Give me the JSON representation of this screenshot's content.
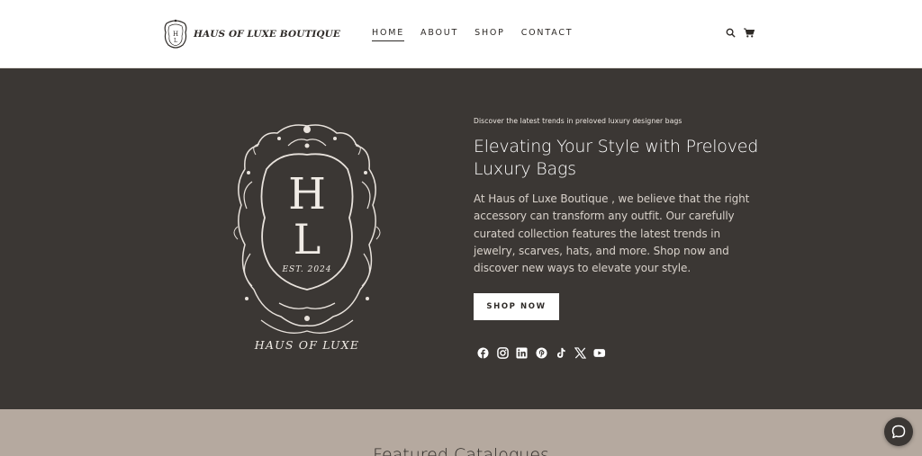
{
  "header": {
    "brand_name": "HAUS OF LUXE BOUTIQUE",
    "nav": [
      {
        "label": "HOME",
        "active": true
      },
      {
        "label": "ABOUT",
        "active": false
      },
      {
        "label": "SHOP",
        "active": false
      },
      {
        "label": "CONTACT",
        "active": false
      }
    ],
    "icons": [
      "search-icon",
      "cart-icon"
    ]
  },
  "hero": {
    "crest": {
      "monogram_top": "H",
      "monogram_bottom": "L",
      "established": "EST. 2024",
      "caption": "HAUS OF LUXE"
    },
    "eyebrow": "Discover the latest trends in preloved luxury designer bags",
    "headline": "Elevating Your Style with Preloved Luxury Bags",
    "body": "At Haus of Luxe Boutique , we believe that the right accessory can transform any outfit. Our carefully curated collection features the latest trends in jewelry, scarves, hats, and more. Shop now and discover new ways to elevate your style.",
    "cta_label": "SHOP NOW",
    "socials": [
      "facebook-icon",
      "instagram-icon",
      "linkedin-icon",
      "pinterest-icon",
      "tiktok-icon",
      "x-icon",
      "youtube-icon"
    ]
  },
  "featured": {
    "title": "Featured Catalogues"
  },
  "colors": {
    "hero_bg": "#3b3734",
    "featured_bg": "#b5a99f",
    "text_dark": "#2e2a27",
    "text_light": "#ffffff"
  }
}
